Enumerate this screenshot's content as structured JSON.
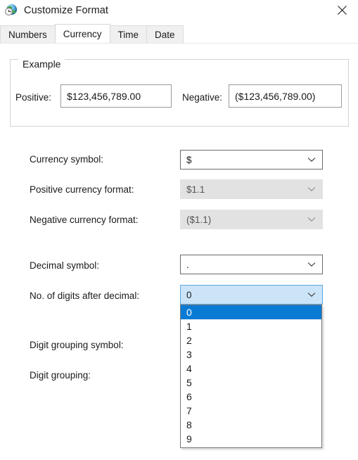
{
  "window": {
    "title": "Customize Format",
    "icon": "region-globe-clock-icon",
    "close_label": "✕"
  },
  "tabs": [
    {
      "label": "Numbers",
      "active": false
    },
    {
      "label": "Currency",
      "active": true
    },
    {
      "label": "Time",
      "active": false
    },
    {
      "label": "Date",
      "active": false
    }
  ],
  "example": {
    "legend": "Example",
    "positive_label": "Positive:",
    "positive_value": "$123,456,789.00",
    "negative_label": "Negative:",
    "negative_value": "($123,456,789.00)"
  },
  "fields": {
    "currency_symbol": {
      "label": "Currency symbol:",
      "value": "$",
      "state": "enabled"
    },
    "positive_currency_format": {
      "label": "Positive currency format:",
      "value": "$1.1",
      "state": "disabled"
    },
    "negative_currency_format": {
      "label": "Negative currency format:",
      "value": "($1.1)",
      "state": "disabled"
    },
    "decimal_symbol": {
      "label": "Decimal symbol:",
      "value": ".",
      "state": "enabled"
    },
    "digits_after_decimal": {
      "label": "No. of digits after decimal:",
      "value": "0",
      "state": "open",
      "options": [
        "0",
        "1",
        "2",
        "3",
        "4",
        "5",
        "6",
        "7",
        "8",
        "9"
      ],
      "selected_index": 0
    },
    "digit_grouping_symbol": {
      "label": "Digit grouping symbol:"
    },
    "digit_grouping": {
      "label": "Digit grouping:"
    }
  },
  "colors": {
    "accent": "#0a7bd4",
    "combo_open_bg": "#cce4f7",
    "disabled_bg": "#e2e2e2",
    "tabstrip_bg": "#f0f0f0",
    "window_bg": "#ffffff"
  }
}
